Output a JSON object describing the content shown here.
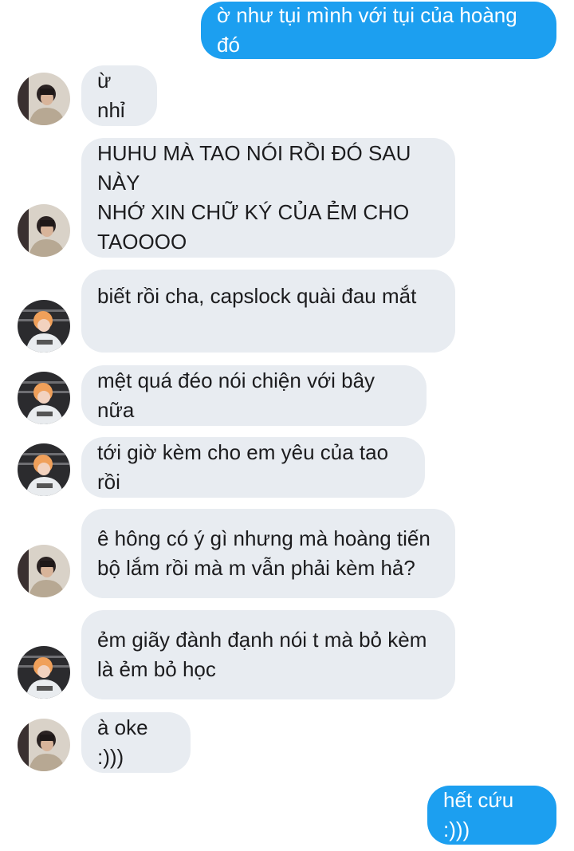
{
  "conversation": {
    "messages": [
      {
        "sender": "me",
        "text": "ờ như tụi mình với tụi của hoàng đó"
      },
      {
        "sender": "friend-dark",
        "text": "ừ nhỉ"
      },
      {
        "sender": "friend-dark",
        "text": "HUHU MÀ TAO NÓI RỒI ĐÓ SAU NÀY\nNHỚ XIN CHỮ KÝ CỦA ẺM CHO\nTAOOOO"
      },
      {
        "sender": "friend-orange",
        "text": "biết rồi cha, capslock quài đau mắt",
        "emoji": "slightly-smiling-face-icon"
      },
      {
        "sender": "friend-orange",
        "text": "mệt quá đéo nói chiện với bây nữa"
      },
      {
        "sender": "friend-orange",
        "text": "tới giờ kèm cho em yêu của tao rồi"
      },
      {
        "sender": "friend-dark",
        "text": "ê hông có ý gì nhưng mà hoàng tiến\nbộ lắm rồi mà m vẫn phải kèm hả?"
      },
      {
        "sender": "friend-orange",
        "text": "ẻm giãy đành đạnh nói t mà bỏ kèm\nlà ẻm bỏ học",
        "emoji": "smiling-face-icon"
      },
      {
        "sender": "friend-dark",
        "text": "à oke :)))"
      },
      {
        "sender": "me",
        "text": "hết cứu :)))"
      }
    ]
  },
  "colors": {
    "outgoing_bubble": "#1c9ff0",
    "incoming_bubble": "#e8ecf1",
    "background": "#ffffff"
  }
}
